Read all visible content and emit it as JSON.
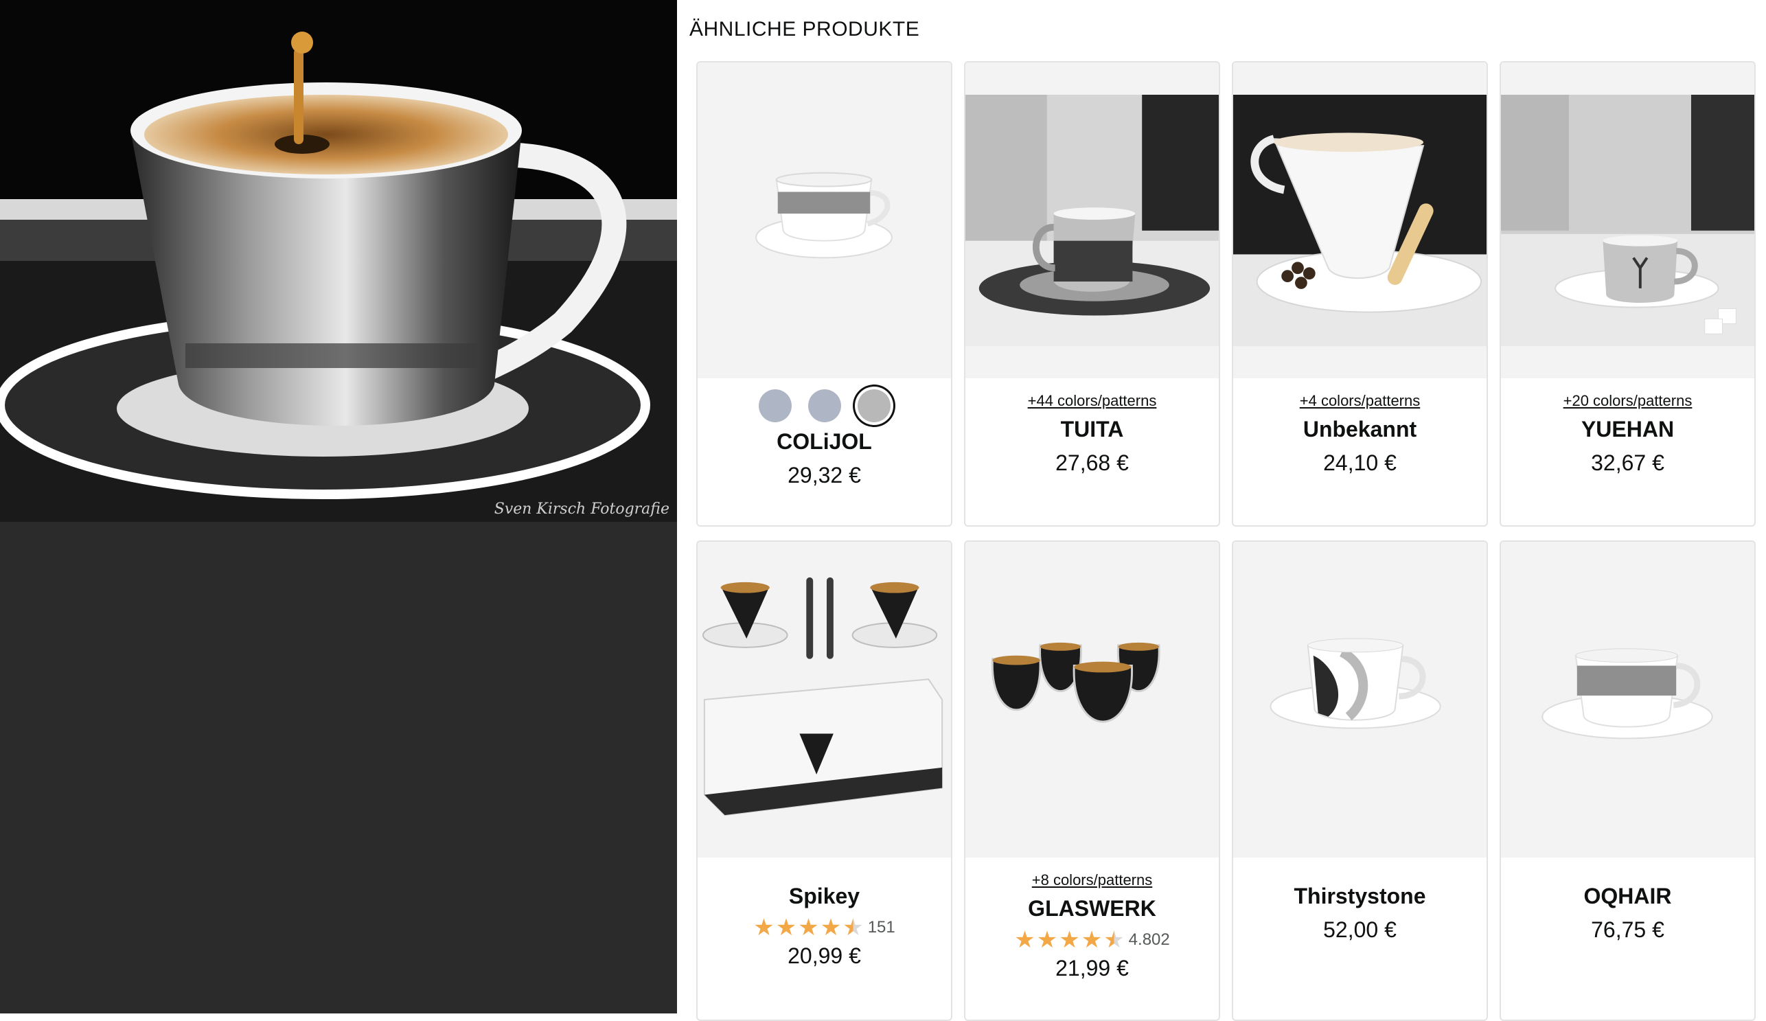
{
  "section_title": "ÄHNLICHE PRODUKTE",
  "hero": {
    "watermark": "Sven Kirsch Fotografie"
  },
  "products": [
    {
      "brand": "COLiJOL",
      "price": "29,32 €",
      "swatches": [
        "#aeb5c4",
        "#aeb5c4",
        "#b8b8b8"
      ],
      "selected_swatch": 3
    },
    {
      "brand": "TUITA",
      "price": "27,68 €",
      "more": "+44 colors/patterns"
    },
    {
      "brand": "Unbekannt",
      "price": "24,10 €",
      "more": "+4 colors/patterns"
    },
    {
      "brand": "YUEHAN",
      "price": "32,67 €",
      "more": "+20 colors/patterns"
    },
    {
      "brand": "Spikey",
      "price": "20,99 €",
      "rating": 4.5,
      "reviews": "151"
    },
    {
      "brand": "GLASWERK",
      "price": "21,99 €",
      "more": "+8 colors/patterns",
      "rating": 4.5,
      "reviews": "4.802"
    },
    {
      "brand": "Thirstystone",
      "price": "52,00 €"
    },
    {
      "brand": "OQHAIR",
      "price": "76,75 €"
    }
  ]
}
